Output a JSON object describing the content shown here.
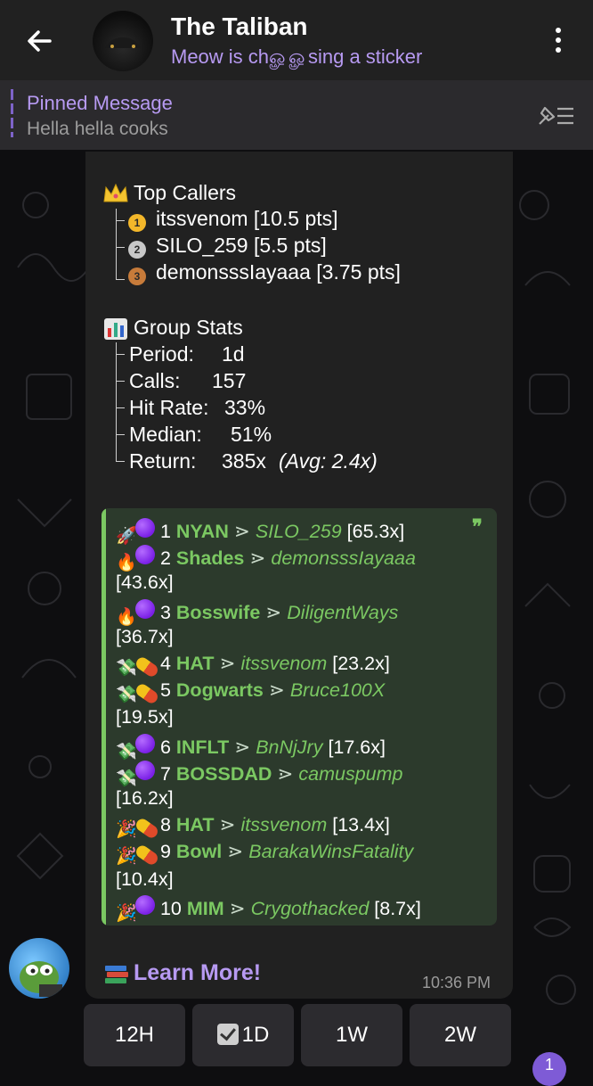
{
  "header": {
    "title": "The Taliban",
    "subtitle": "Meow is chௐௐsing a sticker"
  },
  "pinned": {
    "label": "Pinned Message",
    "text": "Hella hella cooks"
  },
  "message": {
    "top_callers_title": "Top Callers",
    "top_callers": [
      {
        "medal": "1",
        "text": "itssvenom [10.5 pts]"
      },
      {
        "medal": "2",
        "text": "SILO_259 [5.5 pts]"
      },
      {
        "medal": "3",
        "text": "demonsssIayaaa [3.75 pts]"
      }
    ],
    "stats_title": "Group Stats",
    "stats": [
      {
        "label": "Period:",
        "value": "1d"
      },
      {
        "label": "Calls:",
        "value": "157"
      },
      {
        "label": "Hit Rate:",
        "value": "33%"
      },
      {
        "label": "Median:",
        "value": "51%"
      },
      {
        "label": "Return:",
        "value": "385x",
        "extra": "(Avg: 2.4x)"
      }
    ],
    "leaderboard": [
      {
        "rank": "1",
        "ticker": "NYAN",
        "user": "SILO_259",
        "mult": "[65.3x]"
      },
      {
        "rank": "2",
        "ticker": "Shades",
        "user": "demonsssIayaaa",
        "mult": "[43.6x]"
      },
      {
        "rank": "3",
        "ticker": "Bosswife",
        "user": "DiligentWays",
        "mult": "[36.7x]"
      },
      {
        "rank": "4",
        "ticker": "HAT",
        "user": "itssvenom",
        "mult": "[23.2x]"
      },
      {
        "rank": "5",
        "ticker": "Dogwarts",
        "user": "Bruce100X",
        "mult": "[19.5x]"
      },
      {
        "rank": "6",
        "ticker": "INFLT",
        "user": "BnNjJry",
        "mult": "[17.6x]"
      },
      {
        "rank": "7",
        "ticker": "BOSSDAD",
        "user": "camuspump",
        "mult": "[16.2x]"
      },
      {
        "rank": "8",
        "ticker": "HAT",
        "user": "itssvenom",
        "mult": "[13.4x]"
      },
      {
        "rank": "9",
        "ticker": "Bowl",
        "user": "BarakaWinsFatality",
        "mult": "[10.4x]"
      },
      {
        "rank": "10",
        "ticker": "MIM",
        "user": "Crygothacked",
        "mult": "[8.7x]"
      }
    ],
    "arrow": "⋗",
    "learn_more": "Learn More!",
    "time": "10:36 PM"
  },
  "keyboard": {
    "buttons": [
      "12H",
      "1D",
      "1W",
      "2W"
    ],
    "selected": "1D"
  },
  "unread_count": "1",
  "colors": {
    "accent": "#b79af2",
    "green": "#7bc862",
    "bubble": "#212121"
  },
  "icons": [
    "back-arrow-icon",
    "more-vert-icon",
    "unpin-icon",
    "crown-icon",
    "bar-chart-icon",
    "rocket-icon",
    "fire-icon",
    "money-wings-icon",
    "party-popper-icon",
    "pill-icon",
    "books-icon",
    "check-box-icon"
  ]
}
